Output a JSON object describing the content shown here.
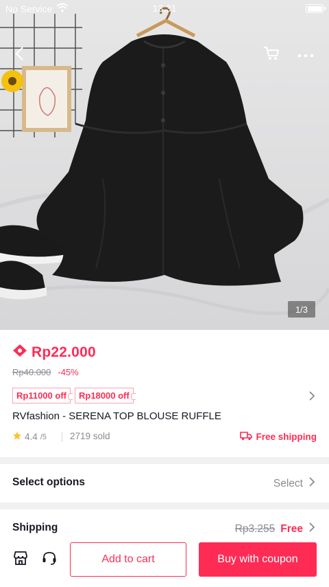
{
  "status_bar": {
    "carrier": "No Service",
    "time": "13.31"
  },
  "gallery": {
    "counter": "1/3"
  },
  "product": {
    "price": "Rp22.000",
    "original_price": "Rp40.000",
    "discount": "-45%",
    "coupons": [
      "Rp11000 off",
      "Rp18000 off"
    ],
    "title": "RVfashion - SERENA TOP BLOUSE RUFFLE",
    "rating": "4.4",
    "rating_denominator": "/5",
    "sold": "2719 sold",
    "free_shipping": "Free shipping"
  },
  "options": {
    "label": "Select options",
    "value": "Select"
  },
  "shipping": {
    "label": "Shipping",
    "original_fee": "Rp3.255",
    "fee": "Free"
  },
  "actions": {
    "add_to_cart": "Add to cart",
    "buy": "Buy with coupon"
  },
  "colors": {
    "accent": "#fe2c55",
    "muted_text": "#8a8b91",
    "star": "#fcc12d"
  },
  "icons": [
    "wifi-icon",
    "battery-icon",
    "back-icon",
    "cart-icon",
    "more-icon",
    "coupon-tag-icon",
    "star-icon",
    "truck-icon",
    "chevron-right-icon",
    "store-icon",
    "headset-icon"
  ]
}
